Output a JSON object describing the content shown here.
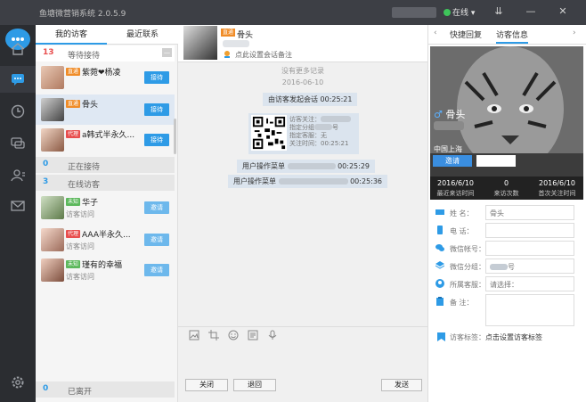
{
  "app": {
    "title": "鱼塘微营销系统 2.0.5.9",
    "status": "在线",
    "status_color": "#3ec45a",
    "accent": "#2e9be6"
  },
  "list": {
    "tabs": [
      "我的访客",
      "最近联系"
    ],
    "waiting": {
      "count": "13",
      "label": "等待接待",
      "collapse": "—"
    },
    "waiting_items": [
      {
        "tag": "直通",
        "tag_color": "#f08c28",
        "name": "紫菀❤杨凌",
        "button": "接待"
      },
      {
        "tag": "直通",
        "tag_color": "#f08c28",
        "name": "骨头",
        "button": "接待"
      },
      {
        "tag": "代理",
        "tag_color": "#e84e4e",
        "name": "a韩式半永久...",
        "button": "接待"
      }
    ],
    "serving": {
      "count": "0",
      "label": "正在接待"
    },
    "online": {
      "count": "3",
      "label": "在线访客"
    },
    "online_items": [
      {
        "tag": "未知",
        "tag_color": "#5cb85c",
        "name": "华子",
        "sub": "访客访问",
        "button": "邀请"
      },
      {
        "tag": "代理",
        "tag_color": "#e84e4e",
        "name": "AAA半永久...",
        "sub": "访客访问",
        "button": "邀请"
      },
      {
        "tag": "未知",
        "tag_color": "#5cb85c",
        "name": "瑾有的幸福",
        "sub": "访客访问",
        "button": "邀请"
      }
    ],
    "left": {
      "count": "0",
      "label": "已离开"
    }
  },
  "chat": {
    "tag": "直通",
    "name": "骨头",
    "note": "点此设置会话备注",
    "no_more": "没有更多记录",
    "date": "2016-06-10",
    "msg1": "由访客发起会话 00:25:21",
    "qr_lines": [
      "访客关注：",
      "指定分组",
      "号",
      "指定客服：无",
      "关注时间：00:25:21"
    ],
    "op1_label": "用户操作菜单",
    "op1_time": "00:25:29",
    "op2_label": "用户操作菜单",
    "op2_time": "00:25:36",
    "close": "关闭",
    "back": "退回",
    "send": "发送"
  },
  "right": {
    "tabs": [
      "快捷回复",
      "访客信息"
    ],
    "name": "骨头",
    "location": "中国上海",
    "invite": "邀请",
    "stats": [
      {
        "value": "2016/6/10",
        "label": "最近来访时间"
      },
      {
        "value": "0",
        "label": "来访次数"
      },
      {
        "value": "2016/6/10",
        "label": "首次关注时间"
      }
    ],
    "fields": [
      {
        "label": "姓      名：",
        "value": "骨头"
      },
      {
        "label": "电      话：",
        "value": ""
      },
      {
        "label": "微信帐号：",
        "value": ""
      },
      {
        "label": "微信分组：",
        "value": "号"
      },
      {
        "label": "所属客服：",
        "value": "请选择："
      },
      {
        "label": "备      注：",
        "value": ""
      }
    ],
    "tag_label": "访客标签：",
    "tag_link": "点击设置访客标签"
  }
}
